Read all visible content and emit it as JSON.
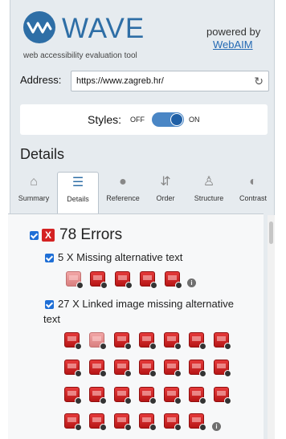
{
  "header": {
    "logo_text": "WAVE",
    "tagline": "web accessibility evaluation tool",
    "powered_by": "powered by",
    "powered_by_link": "WebAIM"
  },
  "address": {
    "label": "Address:",
    "value": "https://www.zagreb.hr/",
    "reload_icon": "reload-icon"
  },
  "styles": {
    "label": "Styles:",
    "off_label": "OFF",
    "on_label": "ON",
    "state": "on"
  },
  "details": {
    "title": "Details",
    "tabs": [
      {
        "label": "Summary",
        "icon": "home-icon",
        "glyph": "⌂"
      },
      {
        "label": "Details",
        "icon": "list-icon",
        "glyph": "☰"
      },
      {
        "label": "Reference",
        "icon": "info-circle-icon",
        "glyph": "●"
      },
      {
        "label": "Order",
        "icon": "order-icon",
        "glyph": "⇵"
      },
      {
        "label": "Structure",
        "icon": "structure-icon",
        "glyph": "♙"
      },
      {
        "label": "Contrast",
        "icon": "contrast-icon",
        "glyph": "◐"
      }
    ],
    "active_tab": "Details"
  },
  "errors": {
    "title": "78 Errors",
    "badge": "X",
    "groups": [
      {
        "label": "5 X Missing alternative text",
        "count": 5
      },
      {
        "label_line1": "27 X Linked image missing alternative",
        "label_line2": "text",
        "count": 27
      }
    ]
  },
  "colors": {
    "brand": "#2e6ea6",
    "error": "#d42222",
    "checkbox": "#1f6fd6",
    "link": "#2469b3"
  }
}
